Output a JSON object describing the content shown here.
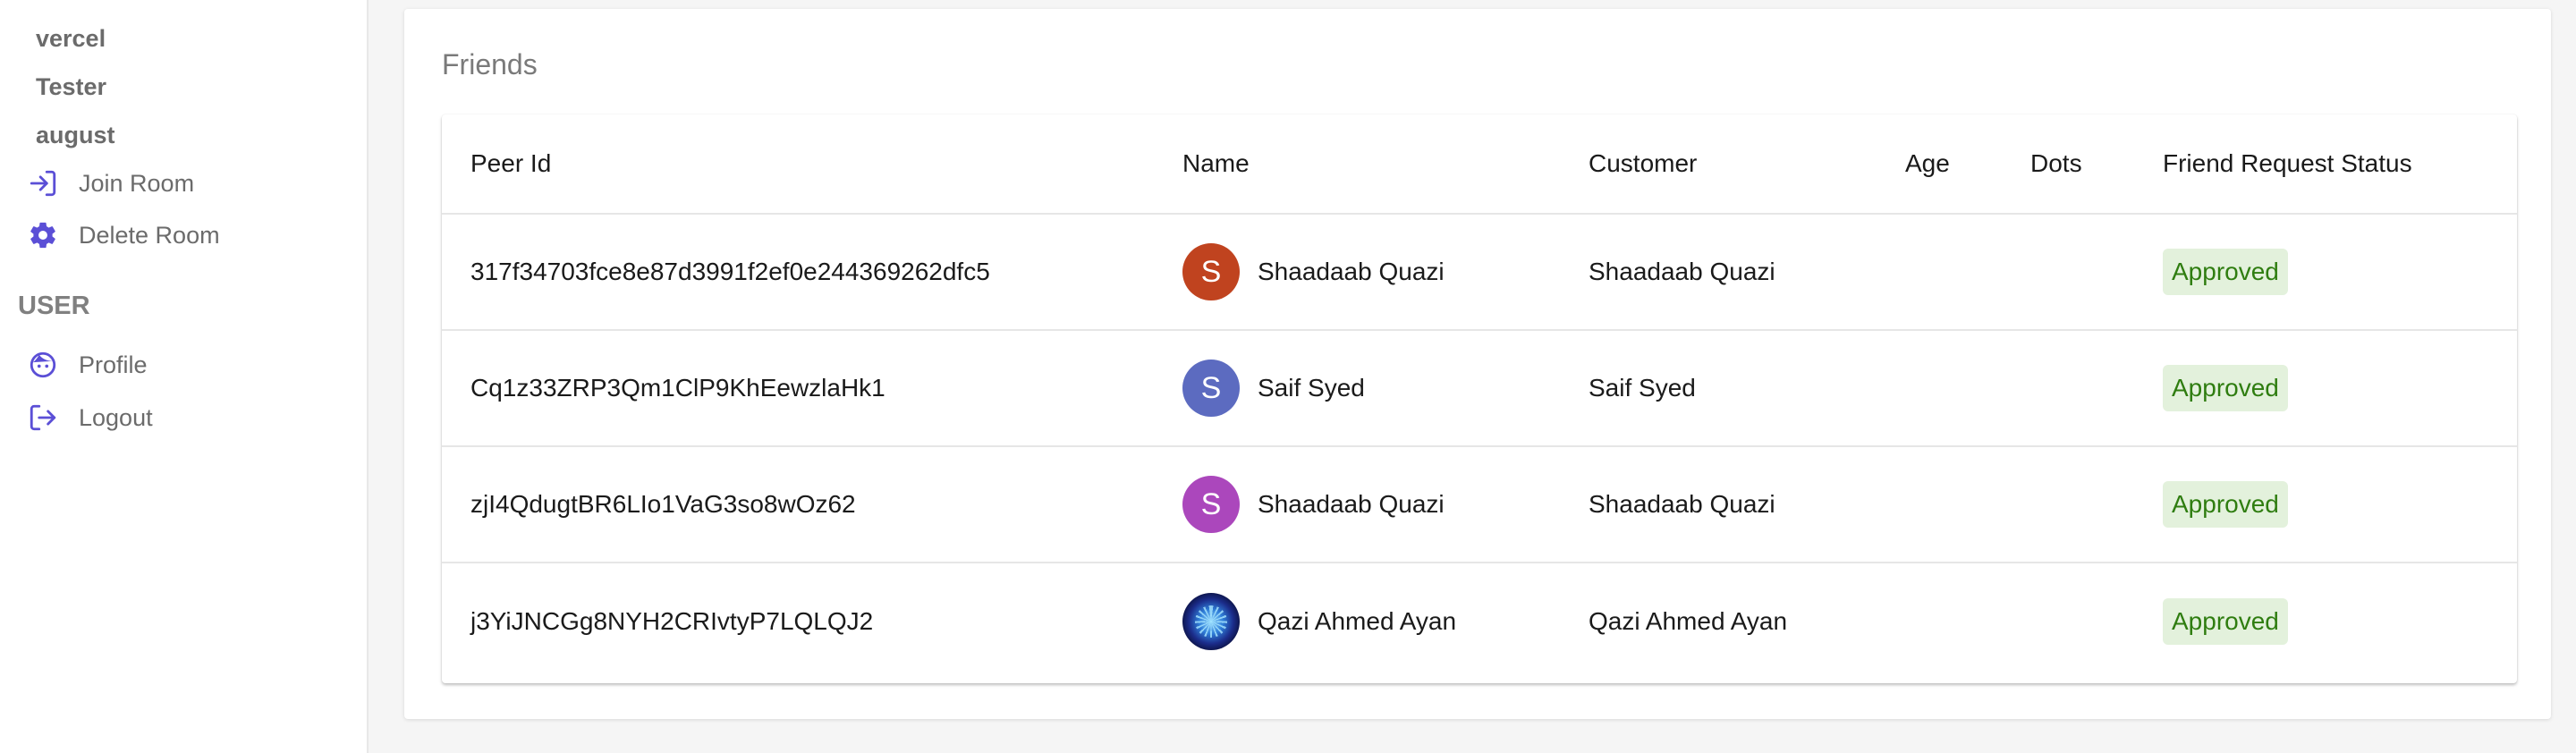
{
  "sidebar": {
    "rooms": [
      "vercel",
      "Tester",
      "august"
    ],
    "actions": [
      {
        "label": "Join Room",
        "icon": "join-icon"
      },
      {
        "label": "Delete Room",
        "icon": "gear-icon"
      }
    ],
    "user_section_title": "USER",
    "user_items": [
      {
        "label": "Profile",
        "icon": "face-icon"
      },
      {
        "label": "Logout",
        "icon": "logout-icon"
      }
    ],
    "accent_color": "#5b4fd6"
  },
  "main": {
    "title": "Friends",
    "table": {
      "columns": [
        "Peer Id",
        "Name",
        "Customer",
        "Age",
        "Dots",
        "Friend Request Status"
      ],
      "rows": [
        {
          "peer_id": "317f34703fce8e87d3991f2ef0e244369262dfc5",
          "avatar_letter": "S",
          "avatar_color": "#c0431f",
          "name": "Shaadaab Quazi",
          "customer": "Shaadaab Quazi",
          "age": "",
          "dots": "",
          "status": "Approved"
        },
        {
          "peer_id": "Cq1z33ZRP3Qm1ClP9KhEewzlaHk1",
          "avatar_letter": "S",
          "avatar_color": "#5c6bc0",
          "name": "Saif Syed",
          "customer": "Saif Syed",
          "age": "",
          "dots": "",
          "status": "Approved"
        },
        {
          "peer_id": "zjI4QdugtBR6LIo1VaG3so8wOz62",
          "avatar_letter": "S",
          "avatar_color": "#ab47bc",
          "name": "Shaadaab Quazi",
          "customer": "Shaadaab Quazi",
          "age": "",
          "dots": "",
          "status": "Approved"
        },
        {
          "peer_id": "j3YiJNCGg8NYH2CRIvtyP7LQLQJ2",
          "avatar_letter": "",
          "avatar_color": "#0a0f3a",
          "name": "Qazi Ahmed Ayan",
          "customer": "Qazi Ahmed Ayan",
          "age": "",
          "dots": "",
          "status": "Approved"
        }
      ]
    },
    "status_colors": {
      "approved_bg": "#e3f1dc",
      "approved_text": "#2f7d10"
    }
  }
}
